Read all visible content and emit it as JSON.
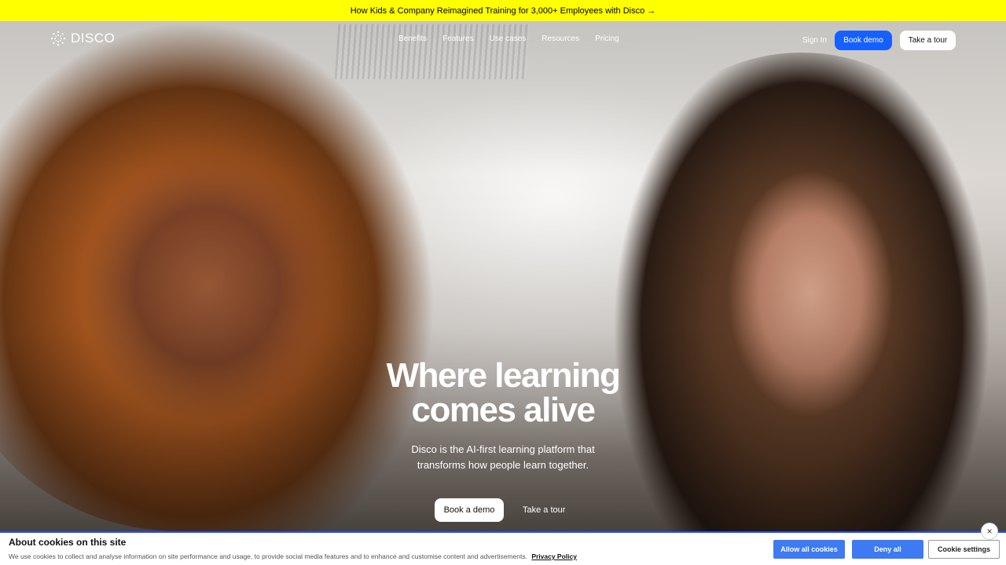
{
  "announcement": {
    "text": "How Kids & Company Reimagined Training for 3,000+ Employees with Disco →"
  },
  "nav": {
    "logo_text": "DISCO",
    "links": [
      "Benefits",
      "Features",
      "Use cases",
      "Resources",
      "Pricing"
    ],
    "sign_in": "Sign In",
    "book_demo": "Book demo",
    "take_tour": "Take a tour"
  },
  "hero": {
    "headline_line1": "Where learning",
    "headline_line2": "comes alive",
    "subline_line1": "Disco is the AI-first learning platform that",
    "subline_line2": "transforms how people learn together.",
    "cta_book": "Book a demo",
    "cta_tour": "Take a tour"
  },
  "cookies": {
    "title": "About cookies on this site",
    "text": "We use cookies to collect and analyse information on site performance and usage, to provide social media features and to enhance and customise content and advertisements.",
    "privacy_link": "Privacy Policy",
    "allow_all": "Allow all cookies",
    "deny_all": "Deny all",
    "settings": "Cookie settings",
    "close_icon": "×"
  },
  "colors": {
    "announcement_bg": "#ffff00",
    "book_demo_bg": "#1560ff",
    "cookie_button_bg": "#3e7af2"
  }
}
